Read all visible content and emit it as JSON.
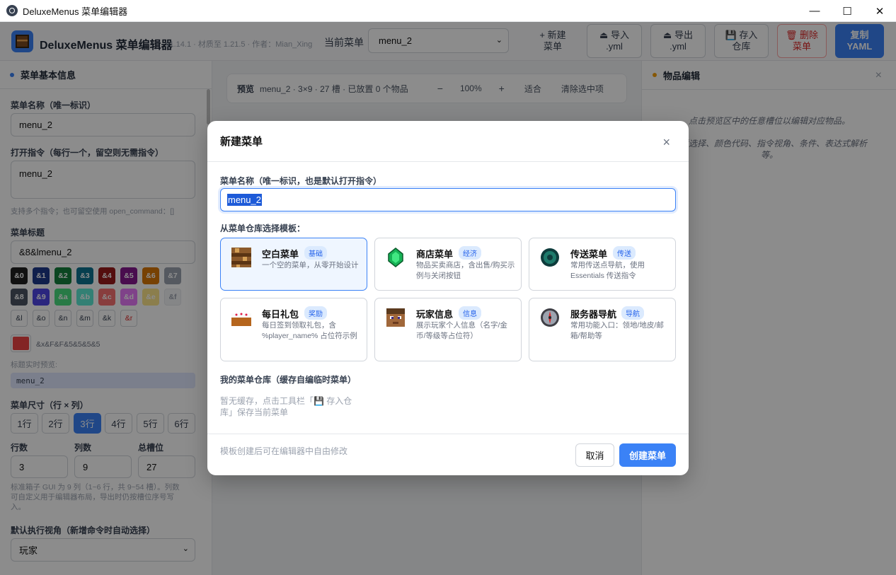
{
  "window": {
    "title": "DeluxeMenus 菜单编辑器",
    "minimize": "—",
    "maximize": "☐",
    "close": "✕"
  },
  "header": {
    "brand": "DeluxeMenus 菜单编辑器",
    "version": "v1.14.1 · 材质至 1.21.5 · 作者：Mian_Xing",
    "current_menu_label": "当前菜单",
    "current_menu_value": "menu_2",
    "buttons": {
      "new_menu": [
        "+ 新建",
        "菜单"
      ],
      "import_yml": [
        "⏏ 导入",
        ".yml"
      ],
      "export_yml": [
        "⏏ 导出",
        ".yml"
      ],
      "save_repo": [
        "💾 存入",
        "仓库"
      ],
      "delete_menu": [
        "🗑 删除",
        "菜单"
      ],
      "copy_yaml": [
        "复制",
        "YAML"
      ]
    }
  },
  "sidebar": {
    "title": "菜单基本信息",
    "name_label": "菜单名称（唯一标识）",
    "name_value": "menu_2",
    "open_cmd_label": "打开指令（每行一个，留空则无需指令）",
    "open_cmd_value": "menu_2",
    "open_cmd_hint": "支持多个指令；也可留空使用 open_command：[]",
    "menu_title_label": "菜单标题",
    "menu_title_value": "&8&lmenu_2",
    "colors": [
      {
        "code": "&0",
        "bg": "#1f1f1f",
        "fg": "#ffffff"
      },
      {
        "code": "&1",
        "bg": "#1e3a8a",
        "fg": "#ffffff"
      },
      {
        "code": "&2",
        "bg": "#15803d",
        "fg": "#ffffff"
      },
      {
        "code": "&3",
        "bg": "#0e7490",
        "fg": "#ffffff"
      },
      {
        "code": "&4",
        "bg": "#991b1b",
        "fg": "#ffffff"
      },
      {
        "code": "&5",
        "bg": "#86198f",
        "fg": "#ffffff"
      },
      {
        "code": "&6",
        "bg": "#d97706",
        "fg": "#ffffff"
      },
      {
        "code": "&7",
        "bg": "#9ca3af",
        "fg": "#ffffff"
      },
      {
        "code": "&8",
        "bg": "#4b5563",
        "fg": "#ffffff"
      },
      {
        "code": "&9",
        "bg": "#4f46e5",
        "fg": "#ffffff"
      },
      {
        "code": "&a",
        "bg": "#4ade80",
        "fg": "#ffffff"
      },
      {
        "code": "&b",
        "bg": "#5eead4",
        "fg": "#ffffff"
      },
      {
        "code": "&c",
        "bg": "#f87171",
        "fg": "#ffffff"
      },
      {
        "code": "&d",
        "bg": "#e879f9",
        "fg": "#ffffff"
      },
      {
        "code": "&e",
        "bg": "#fde68a",
        "fg": "#ffffff"
      },
      {
        "code": "&f",
        "bg": "#f3f4f6",
        "fg": "#9ca3af"
      }
    ],
    "formats": [
      "&l",
      "&o",
      "&n",
      "&m",
      "&k",
      "&r"
    ],
    "custom_color_value": "&x&F&F&5&5&5&5",
    "custom_color_swatch": "#ef4444",
    "live_preview_label": "标题实时预览:",
    "live_preview_value": "menu_2",
    "size_label": "菜单尺寸（行 × 列）",
    "rows": [
      "1行",
      "2行",
      "3行",
      "4行",
      "5行",
      "6行"
    ],
    "active_row": "3行",
    "rows_label": "行数",
    "rows_value": "3",
    "cols_label": "列数",
    "cols_value": "9",
    "slots_label": "总槽位",
    "slots_value": "27",
    "size_hint": [
      "标准箱子 GUI 为 9 列（1~6 行，共 9~54 槽）。列数",
      "可自定义用于编辑器布局，导出时仍按槽位序号写",
      "入。"
    ],
    "exec_view_label": "默认执行视角（新增命令时自动选择）",
    "exec_view_value": "玩家"
  },
  "preview": {
    "label": "预览",
    "info": "menu_2 · 3×9 · 27 槽 · 已放置 0 个物品",
    "zoom_out": "−",
    "zoom": "100%",
    "zoom_in": "+",
    "fit": "适合",
    "clear": "清除选中项"
  },
  "item_editor": {
    "title": "物品编辑",
    "close": "×",
    "hint1": "点击预览区中的任意槽位以编辑对应物品。",
    "hint2": "材质选择、颜色代码、指令视角、条件、表达式解析",
    "hint3": "等。"
  },
  "modal": {
    "title": "新建菜单",
    "close": "×",
    "name_label": "菜单名称（唯一标识，也是默认打开指令）",
    "name_value": "menu_2",
    "template_label": "从菜单仓库选择模板：",
    "templates": [
      {
        "name": "空白菜单",
        "tag": "基础",
        "desc": "一个空的菜单，从零开始设计"
      },
      {
        "name": "商店菜单",
        "tag": "经济",
        "desc": "物品买卖商店，含出售/购买示例与关闭按钮"
      },
      {
        "name": "传送菜单",
        "tag": "传送",
        "desc": "常用传送点导航，使用 Essentials 传送指令"
      },
      {
        "name": "每日礼包",
        "tag": "奖励",
        "desc": "每日签到领取礼包，含 %player_name% 占位符示例"
      },
      {
        "name": "玩家信息",
        "tag": "信息",
        "desc": "展示玩家个人信息（名字/金币/等级等占位符）"
      },
      {
        "name": "服务器导航",
        "tag": "导航",
        "desc": "常用功能入口：领地/地皮/邮箱/帮助等"
      }
    ],
    "my_repo_label": "我的菜单仓库（缓存自编临时菜单）",
    "empty_repo": [
      "暂无缓存，点击工具栏「💾 存入仓",
      "库」保存当前菜单"
    ],
    "footer_hint": "模板创建后可在编辑器中自由修改",
    "cancel": "取消",
    "create": "创建菜单"
  }
}
